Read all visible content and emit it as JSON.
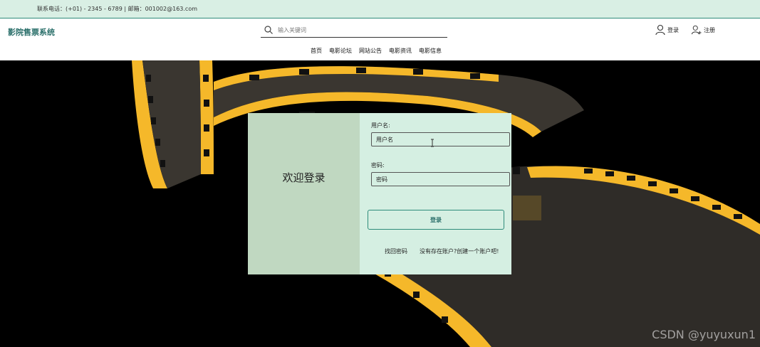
{
  "topbar": {
    "contact": "联系电话：(+01) - 2345 - 6789 | 邮箱：001002@163.com"
  },
  "header": {
    "brand": "影院售票系统",
    "search_placeholder": "输入关键词",
    "login_label": "登录",
    "register_label": "注册"
  },
  "nav": {
    "items": [
      "首页",
      "电影论坛",
      "网站公告",
      "电影资讯",
      "电影信息"
    ]
  },
  "login_card": {
    "welcome": "欢迎登录",
    "username_label": "用户名:",
    "username_placeholder": "用户名",
    "password_label": "密码:",
    "password_placeholder": "密码",
    "submit_label": "登录",
    "forgot_link": "找回密码",
    "register_link": "没有存在账户?创建一个账户吧!"
  },
  "watermark": "CSDN @yuyuxun1",
  "colors": {
    "accent": "#2a6f6a",
    "topbar_bg": "#d9efe4",
    "card_left": "#c0d8c1",
    "card_right": "#d5efe2",
    "film_yellow": "#f5b82a"
  }
}
